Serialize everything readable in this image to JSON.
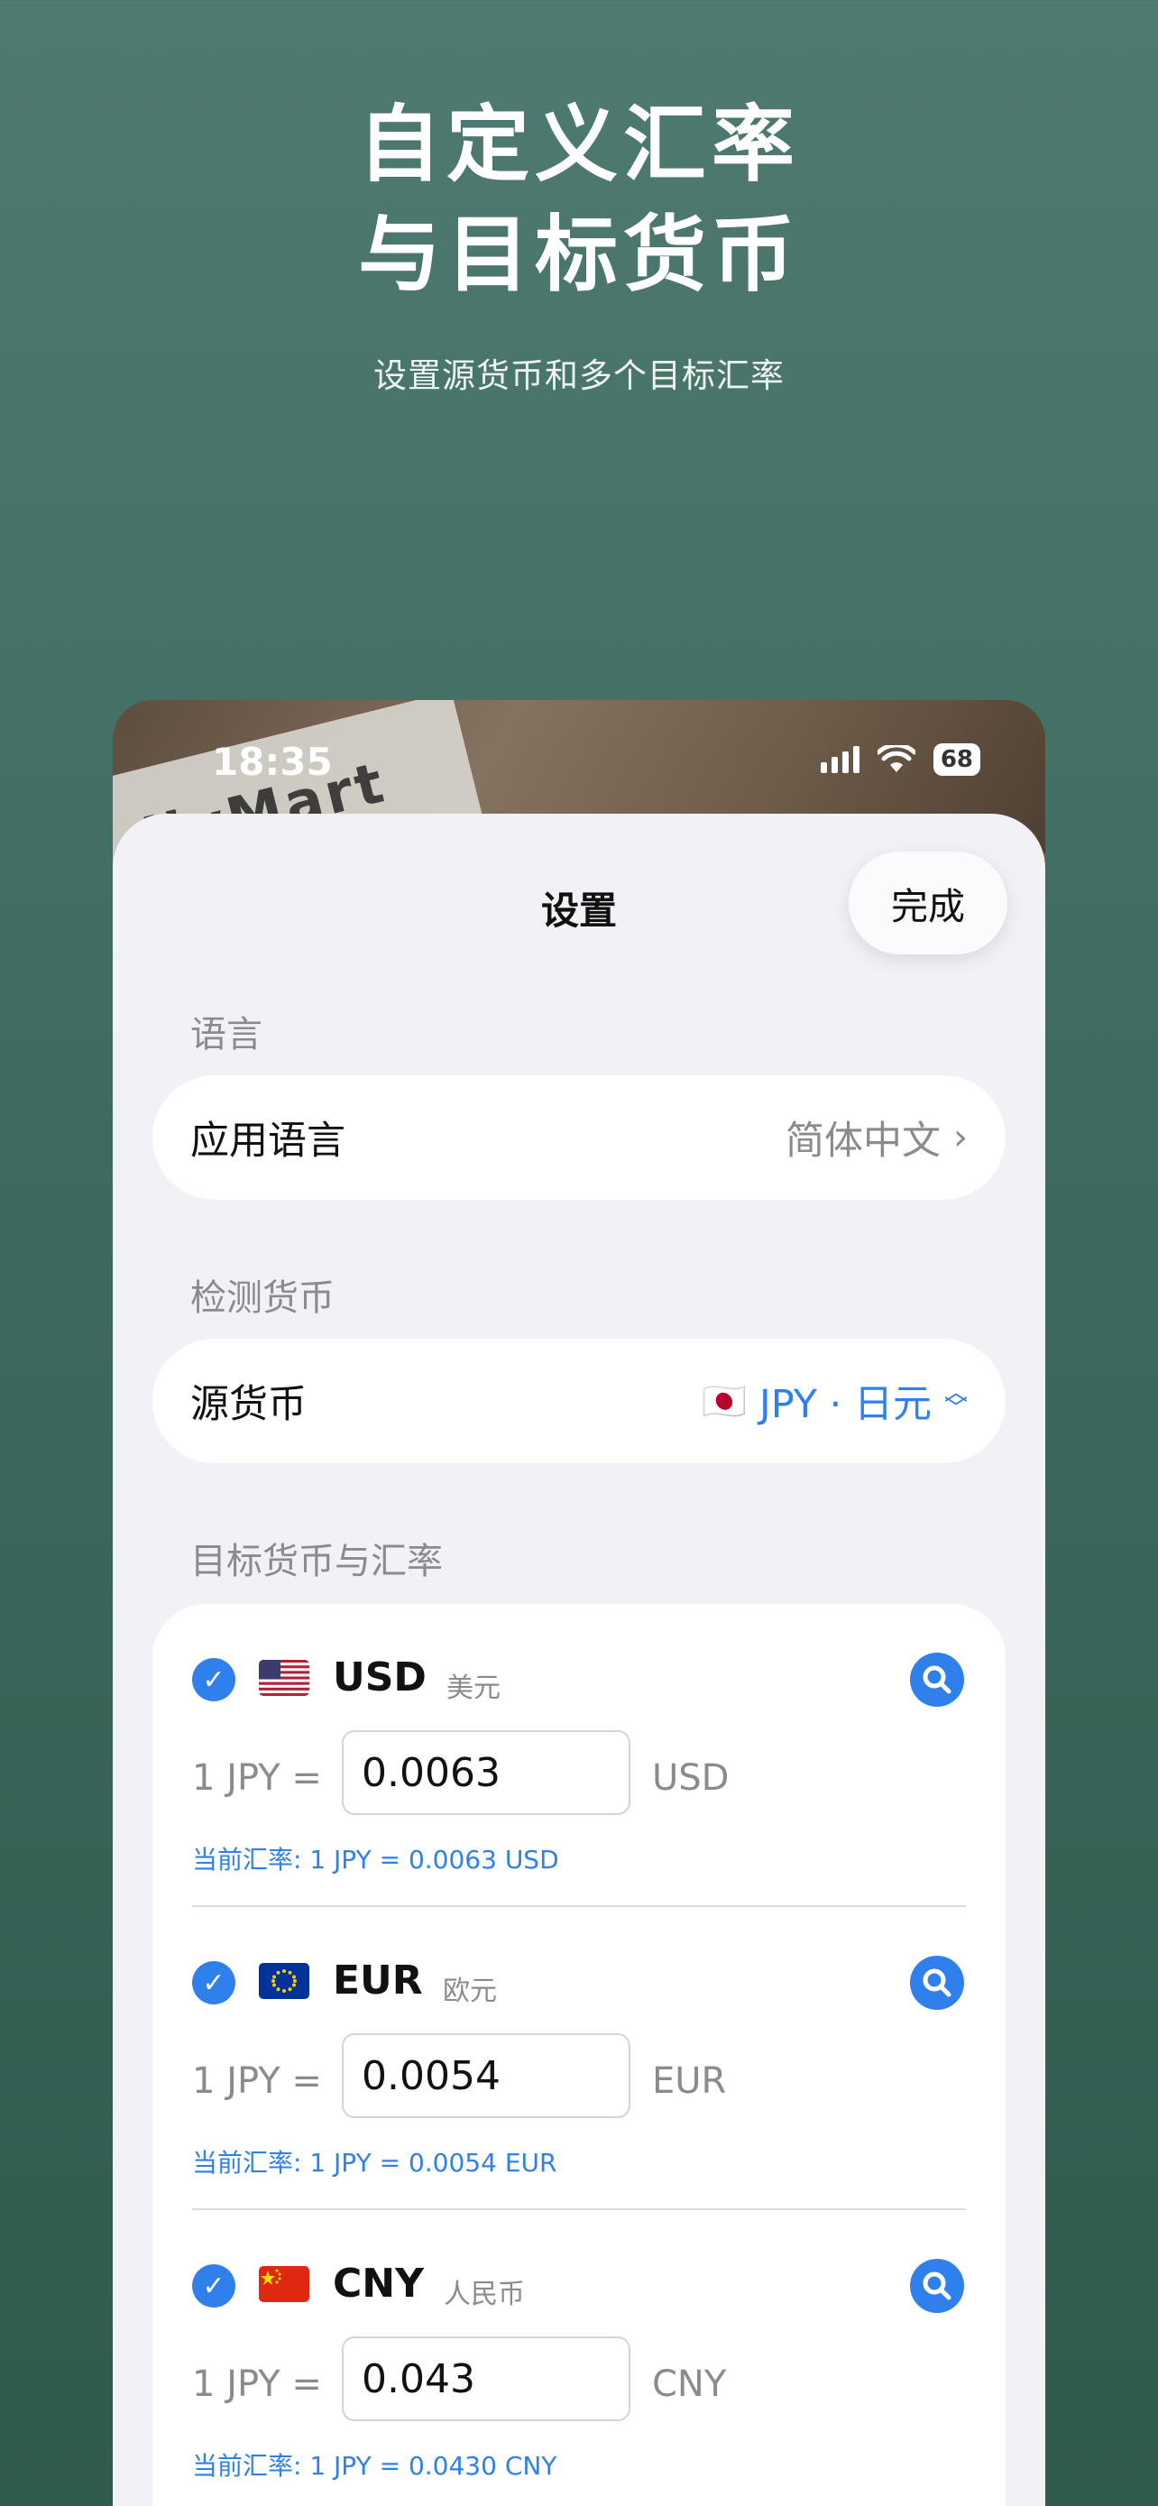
{
  "hero": {
    "title_line1": "自定义汇率",
    "title_line2": "与目标货币",
    "subtitle": "设置源货币和多个目标汇率"
  },
  "status_bar": {
    "time": "18:35",
    "battery": "68"
  },
  "background_photo_text": "ilyMart",
  "settings": {
    "title": "设置",
    "done_label": "完成",
    "language_section": "语言",
    "app_language_label": "应用语言",
    "app_language_value": "简体中文",
    "detect_section": "检测货币",
    "source_currency_label": "源货币",
    "source_currency_flag": "🇯🇵",
    "source_currency_value": "JPY · 日元",
    "target_section": "目标货币与汇率"
  },
  "targets": [
    {
      "flag": "us",
      "code": "USD",
      "name": "美元",
      "prefix": "1 JPY =",
      "rate": "0.0063",
      "unit": "USD",
      "current": "当前汇率: 1 JPY = 0.0063 USD",
      "checked": true
    },
    {
      "flag": "eu",
      "code": "EUR",
      "name": "欧元",
      "prefix": "1 JPY =",
      "rate": "0.0054",
      "unit": "EUR",
      "current": "当前汇率: 1 JPY = 0.0054 EUR",
      "checked": true
    },
    {
      "flag": "cn",
      "code": "CNY",
      "name": "人民币",
      "prefix": "1 JPY =",
      "rate": "0.043",
      "unit": "CNY",
      "current": "当前汇率: 1 JPY = 0.0430 CNY",
      "checked": true
    }
  ],
  "colors": {
    "accent": "#2f80ed",
    "background": "#46756a",
    "sheet": "#f2f2f6"
  }
}
